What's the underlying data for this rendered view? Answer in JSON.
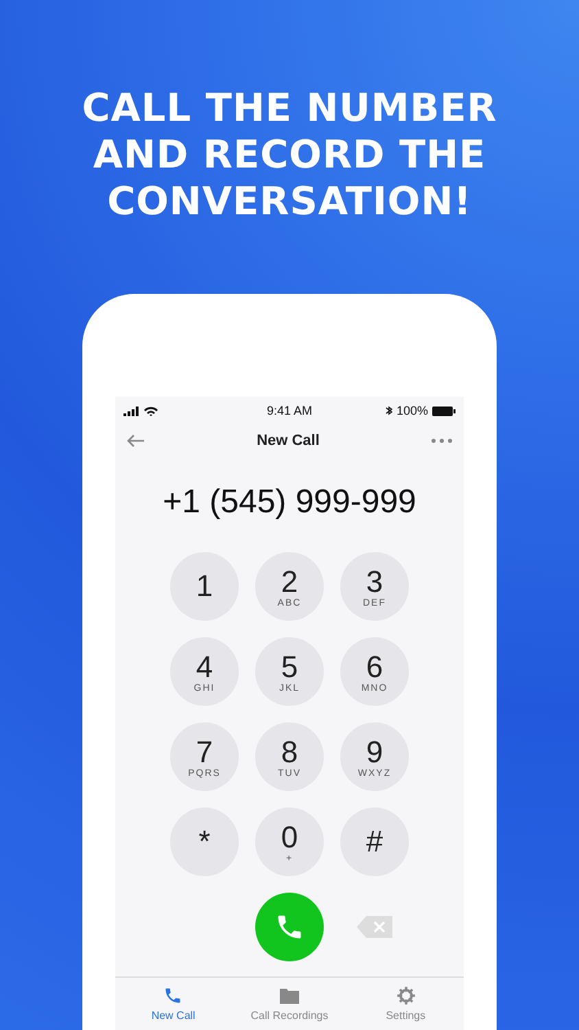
{
  "headline_lines": [
    "CALL THE NUMBER",
    "AND RECORD THE",
    "CONVERSATION!"
  ],
  "status_bar": {
    "time": "9:41 AM",
    "battery": "100%"
  },
  "nav": {
    "title": "New Call"
  },
  "number": "+1 (545) 999-999",
  "keys": [
    {
      "digit": "1"
    },
    {
      "digit": "2",
      "letters": "ABC"
    },
    {
      "digit": "3",
      "letters": "DEF"
    },
    {
      "digit": "4",
      "letters": "GHI"
    },
    {
      "digit": "5",
      "letters": "JKL"
    },
    {
      "digit": "6",
      "letters": "MNO"
    },
    {
      "digit": "7",
      "letters": "PQRS"
    },
    {
      "digit": "8",
      "letters": "TUV"
    },
    {
      "digit": "9",
      "letters": "WXYZ"
    },
    {
      "digit": "*"
    },
    {
      "digit": "0",
      "letters": "+"
    },
    {
      "digit": "#"
    }
  ],
  "tabs": [
    {
      "kind": "call",
      "label": "New Call",
      "selected": true
    },
    {
      "kind": "folder",
      "label": "Call Recordings",
      "selected": false
    },
    {
      "kind": "gear",
      "label": "Settings",
      "selected": false
    }
  ]
}
